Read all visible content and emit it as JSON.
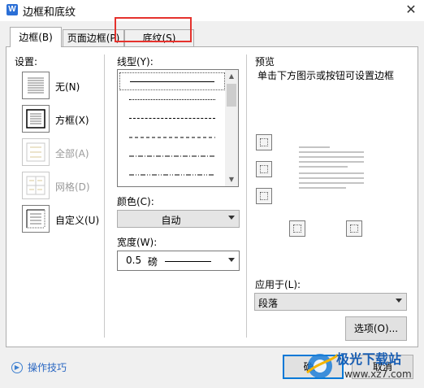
{
  "window": {
    "title": "边框和底纹",
    "app_icon": "W"
  },
  "tabs": [
    {
      "label": "边框(B)",
      "active": true
    },
    {
      "label": "页面边框(P)",
      "active": false
    },
    {
      "label": "底纹(S)",
      "active": false
    }
  ],
  "settings": {
    "heading": "设置:",
    "items": [
      {
        "label": "无(N)",
        "enabled": true,
        "icon": "border-none-icon"
      },
      {
        "label": "方框(X)",
        "enabled": true,
        "icon": "border-box-icon"
      },
      {
        "label": "全部(A)",
        "enabled": false,
        "icon": "border-all-icon"
      },
      {
        "label": "网格(D)",
        "enabled": false,
        "icon": "border-grid-icon"
      },
      {
        "label": "自定义(U)",
        "enabled": true,
        "icon": "border-custom-icon"
      }
    ]
  },
  "line_style": {
    "label": "线型(Y):",
    "styles": [
      "solid",
      "dotted",
      "dense-dashed",
      "dashed",
      "dash-dot",
      "dash-dot-dot",
      "long-dash"
    ]
  },
  "color": {
    "label": "颜色(C):",
    "value": "自动"
  },
  "width": {
    "label": "宽度(W):",
    "value": "0.5",
    "unit": "磅"
  },
  "preview": {
    "title": "预览",
    "hint": "单击下方图示或按钮可设置边框"
  },
  "apply_to": {
    "label": "应用于(L):",
    "value": "段落"
  },
  "buttons": {
    "options": "选项(O)...",
    "ok": "确定",
    "cancel": "取消"
  },
  "footer": {
    "tips": "操作技巧"
  },
  "watermark": {
    "cn": "极光下载站",
    "url": "www.xz7.com"
  },
  "colors": {
    "highlight": "#e5322d",
    "accent": "#0078d7",
    "link": "#2a67c2"
  }
}
